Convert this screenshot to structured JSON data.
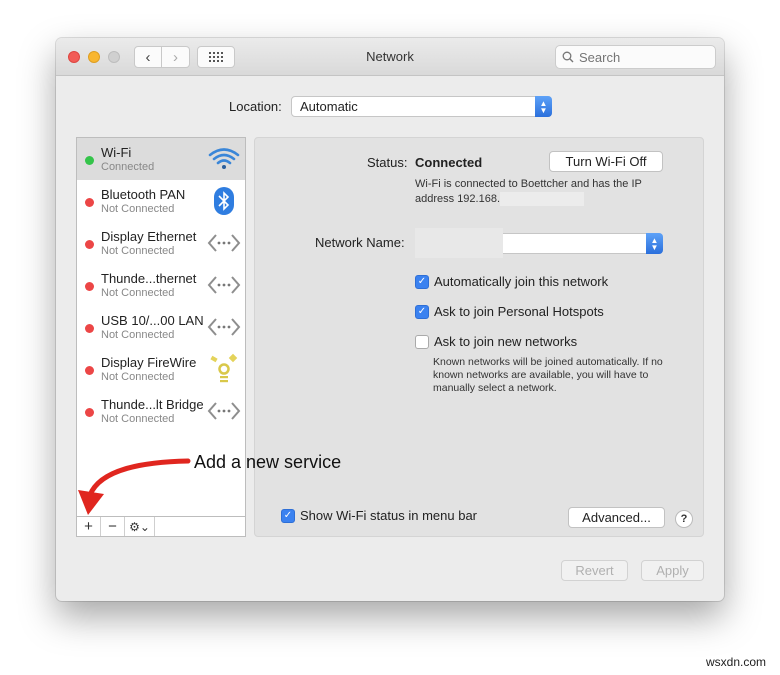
{
  "window": {
    "title": "Network",
    "search_placeholder": "Search",
    "nav": {
      "back": "‹",
      "forward": "›"
    }
  },
  "location": {
    "label": "Location:",
    "value": "Automatic"
  },
  "services": [
    {
      "name": "Wi-Fi",
      "status": "Connected",
      "dot_color": "#34c44a",
      "icon": "wifi-icon",
      "selected": true
    },
    {
      "name": "Bluetooth PAN",
      "status": "Not Connected",
      "dot_color": "#ec4646",
      "icon": "bluetooth-icon",
      "selected": false
    },
    {
      "name": "Display Ethernet",
      "status": "Not Connected",
      "dot_color": "#ec4646",
      "icon": "ethernet-icon",
      "selected": false
    },
    {
      "name": "Thunde...thernet",
      "status": "Not Connected",
      "dot_color": "#ec4646",
      "icon": "ethernet-icon",
      "selected": false
    },
    {
      "name": "USB 10/...00 LAN",
      "status": "Not Connected",
      "dot_color": "#ec4646",
      "icon": "ethernet-icon",
      "selected": false
    },
    {
      "name": "Display FireWire",
      "status": "Not Connected",
      "dot_color": "#ec4646",
      "icon": "firewire-icon",
      "selected": false
    },
    {
      "name": "Thunde...lt Bridge",
      "status": "Not Connected",
      "dot_color": "#ec4646",
      "icon": "ethernet-icon",
      "selected": false
    }
  ],
  "list_toolbar": {
    "add": "+",
    "remove": "−",
    "gear": "⚙⌄"
  },
  "detail": {
    "status_label": "Status:",
    "status_value": "Connected",
    "turn_off_button": "Turn Wi-Fi Off",
    "status_desc_line1": "Wi-Fi is connected to Boettcher and has the IP",
    "status_desc_line2": "address 192.168.",
    "network_name_label": "Network Name:",
    "checkboxes": [
      {
        "label": "Automatically join this network",
        "checked": true
      },
      {
        "label": "Ask to join Personal Hotspots",
        "checked": true
      },
      {
        "label": "Ask to join new networks",
        "checked": false
      }
    ],
    "hint": "Known networks will be joined automatically. If no known networks are available, you will have to manually select a network.",
    "show_status_label": "Show Wi-Fi status in menu bar",
    "show_status_checked": true,
    "advanced_button": "Advanced...",
    "help_button": "?"
  },
  "footer": {
    "revert_button": "Revert",
    "apply_button": "Apply"
  },
  "annotation": {
    "text": "Add a new service",
    "color": "#e0261f"
  },
  "watermark": "wsxdn.com"
}
